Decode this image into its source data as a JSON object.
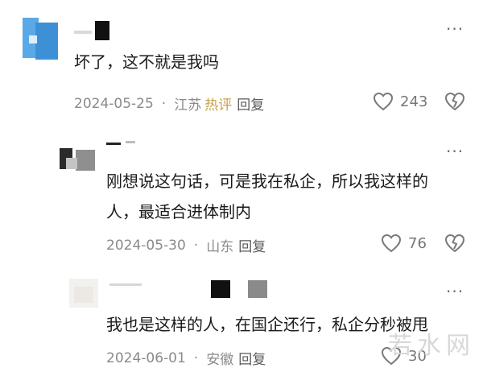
{
  "comments": [
    {
      "text": "坏了，这不就是我吗",
      "date": "2024-05-25",
      "location": "江苏",
      "hot_tag": "热评",
      "reply_label": "回复",
      "likes": "243"
    },
    {
      "text_line1": "刚想说这句话，可是我在私企，所以我这样的",
      "text_line2": "人，最适合进体制内",
      "date": "2024-05-30",
      "location": "山东",
      "reply_label": "回复",
      "likes": "76"
    },
    {
      "text": "我也是这样的人，在国企还行，私企分秒被甩",
      "date": "2024-06-01",
      "location": "安徽",
      "reply_label": "回复",
      "likes": "30"
    }
  ],
  "icons": {
    "more": "more-dots-icon",
    "like": "heart-outline-icon",
    "dislike": "broken-heart-icon"
  },
  "watermark": "若水网",
  "colors": {
    "hot_tag": "#c7a14a",
    "meta_text": "#8a8a8a",
    "icon_gray": "#7a7a7a"
  }
}
